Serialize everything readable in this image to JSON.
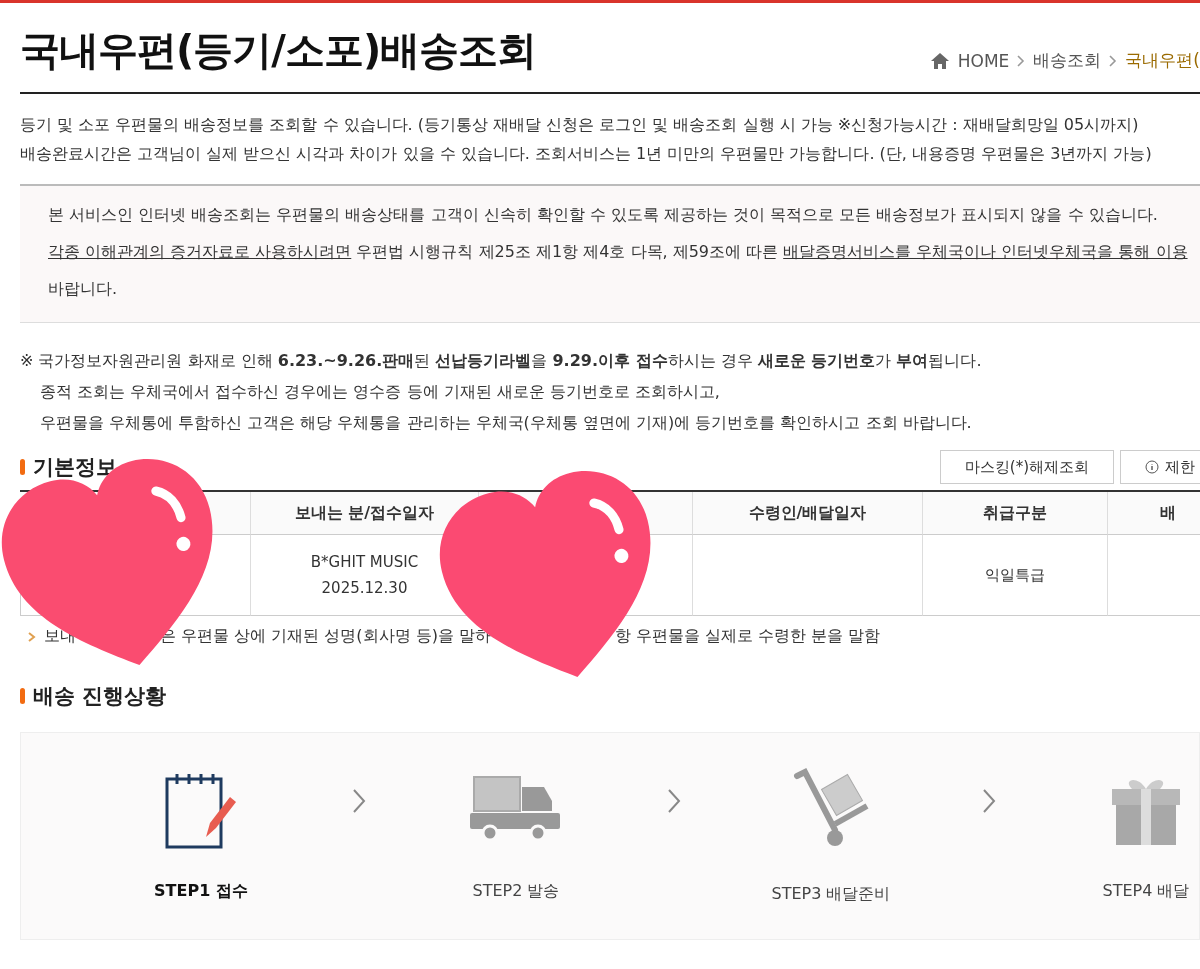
{
  "page_title": "국내우편(등기/소포)배송조회",
  "breadcrumb": [
    {
      "label": "HOME",
      "kind": "home",
      "selected": false
    },
    {
      "label": "배송조회",
      "kind": "link",
      "selected": false
    },
    {
      "label": "국내우편(",
      "kind": "link",
      "selected": true
    }
  ],
  "description": [
    "등기 및 소포 우편물의 배송정보를 조회할 수 있습니다. (등기통상 재배달 신청은 로그인 및 배송조회 실행 시 가능 ※신청가능시간 : 재배달희망일 05시까지)",
    "배송완료시간은 고객님이 실제 받으신 시각과 차이가 있을 수 있습니다. 조회서비스는 1년 미만의 우편물만 가능합니다. (단, 내용증명 우편물은 3년까지 가능)"
  ],
  "notice": [
    [
      {
        "text": "본 서비스인 인터넷 배송조회는 우편물의 배송상태를 고객이 신속히 확인할 수 있도록 제공하는 것이 목적으로 모든 배송정보가 표시되지 않을 수 있습니다.",
        "link": false
      }
    ],
    [
      {
        "text": "각종 이해관계의 증거자료로 사용하시려면",
        "link": true
      },
      {
        "text": " 우편법 시행규칙 제25조 제1항 제4호 다목, 제59조에 따른 ",
        "link": false
      },
      {
        "text": "배달증명서비스를 우체국이나 인터넷우체국을 통해 이용",
        "link": true
      }
    ],
    [
      {
        "text": "바랍니다.",
        "link": false
      }
    ]
  ],
  "alert": [
    "※ 국가정보자원관리원 화재로 인해 **6.23.~9.26.판매**된 **선납등기라벨**을 **9.29.이후 접수**하시는 경우 **새로운 등기번호**가 **부여**됩니다.",
    "종적 조회는 우체국에서 접수하신 경우에는 영수증 등에 기재된 새로운 등기번호로 조회하시고,",
    "우편물을 우체통에 투함하신 고객은 해당 우체통을 관리하는 우체국(우체통 옆면에 기재)에 등기번호를 확인하시고 조회 바랍니다."
  ],
  "basic_info": {
    "heading": "기본정보",
    "buttons": [
      {
        "label": "마스킹(*)해제조회",
        "kind": "plain"
      },
      {
        "label": "제한",
        "kind": "info"
      }
    ],
    "columns": [
      {},
      {
        "label": "보내는 분/접수일자"
      },
      {},
      {
        "label": "수령인/배달일자"
      },
      {
        "label": "취급구분"
      },
      {
        "label": "배"
      }
    ],
    "row": {
      "column_2": [
        "B*GHIT MUSIC",
        "2025.12.30"
      ],
      "column_5": [
        "익일특급"
      ]
    },
    "note": [
      "보내",
      "은 우편물 상에 기재된 성명(회사명 등)을 말하",
      "항 우편물을 실제로 수령한 분을 말함"
    ]
  },
  "progress": {
    "heading": "배송 진행상황",
    "steps": [
      {
        "label": "STEP1 접수",
        "kind": "accept",
        "selected": true
      },
      {
        "label": "STEP2 발송",
        "kind": "truck",
        "selected": false
      },
      {
        "label": "STEP3 배달준비",
        "kind": "cart",
        "selected": false
      },
      {
        "label": "STEP4 배달",
        "kind": "gift",
        "selected": false
      }
    ]
  },
  "stickers": [
    {
      "kind": "heart"
    },
    {
      "kind": "heart"
    }
  ]
}
